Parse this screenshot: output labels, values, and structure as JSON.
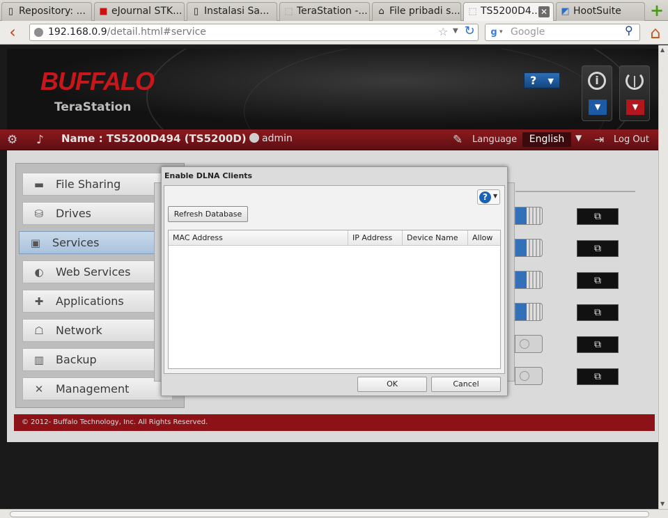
{
  "browser": {
    "tabs": [
      {
        "label": "Repository: ..."
      },
      {
        "label": "eJournal STK..."
      },
      {
        "label": "Instalasi Sa..."
      },
      {
        "label": "TeraStation -..."
      },
      {
        "label": "File pribadi s..."
      },
      {
        "label": "TS5200D4..."
      },
      {
        "label": "HootSuite"
      }
    ],
    "url_host": "192.168.0.9",
    "url_path": "/detail.html#service",
    "search_placeholder": "Google"
  },
  "header": {
    "logo": "BUFFALO",
    "product": "TeraStation",
    "help_label": "?"
  },
  "topbar": {
    "name_label": "Name : TS5200D494 (TS5200D)",
    "user": "admin",
    "language_label": "Language",
    "language_value": "English",
    "logout_label": "Log Out"
  },
  "sidebar": {
    "items": [
      {
        "label": "File Sharing"
      },
      {
        "label": "Drives"
      },
      {
        "label": "Services",
        "active": true
      },
      {
        "label": "Web Services"
      },
      {
        "label": "Applications"
      },
      {
        "label": "Network"
      },
      {
        "label": "Backup"
      },
      {
        "label": "Management"
      }
    ]
  },
  "services": {
    "toggles": [
      true,
      true,
      true,
      true,
      false,
      false
    ]
  },
  "dialog": {
    "title": "Enable DLNA Clients",
    "help_label": "?",
    "refresh_label": "Refresh Database",
    "columns": [
      "MAC Address",
      "IP Address",
      "Device Name",
      "Allow"
    ],
    "ok_label": "OK",
    "cancel_label": "Cancel"
  },
  "footer": {
    "copyright": "© 2012- Buffalo Technology, Inc. All Rights Reserved."
  }
}
